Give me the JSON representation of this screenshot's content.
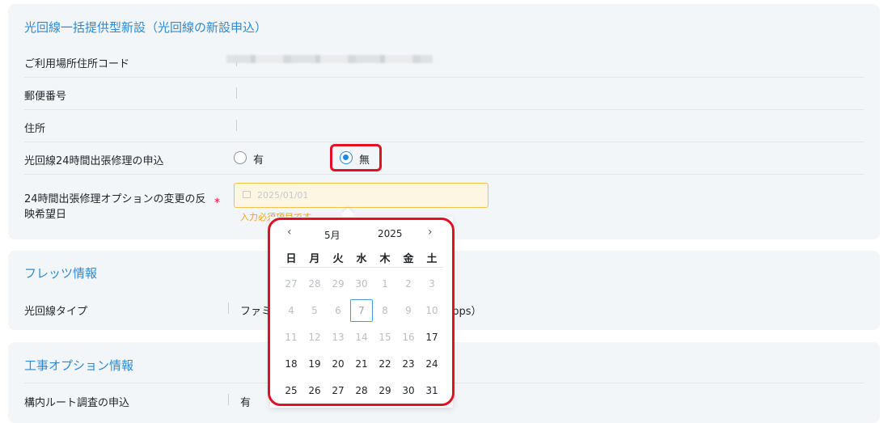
{
  "section1": {
    "title": "光回線一括提供型新設（光回線の新設申込）",
    "rows": {
      "address_code": "ご利用場所住所コード",
      "postal": "郵便番号",
      "address": "住所",
      "repair": "光回線24時間出張修理の申込",
      "desired_date_line1": "24時間出張修理オプションの変更の反",
      "desired_date_line2": "映希望日"
    },
    "radio_yes": "有",
    "radio_no": "無",
    "radio_selected": "無",
    "date_placeholder": "2025/01/01",
    "error_text": "入力必須項目です",
    "required_mark": "*"
  },
  "calendar": {
    "month": "5月",
    "year": "2025",
    "prev_icon": "‹",
    "next_icon": "›",
    "weekdays": [
      "日",
      "月",
      "火",
      "水",
      "木",
      "金",
      "土"
    ],
    "weeks": [
      [
        "27",
        "28",
        "29",
        "30",
        "1",
        "2",
        "3"
      ],
      [
        "4",
        "5",
        "6",
        "7",
        "8",
        "9",
        "10"
      ],
      [
        "11",
        "12",
        "13",
        "14",
        "15",
        "16",
        "17"
      ],
      [
        "18",
        "19",
        "20",
        "21",
        "22",
        "23",
        "24"
      ],
      [
        "25",
        "26",
        "27",
        "28",
        "29",
        "30",
        "31"
      ]
    ],
    "today": "7"
  },
  "section2": {
    "title": "フレッツ情報",
    "line_type_label": "光回線タイプ",
    "line_type_value_start": "ファミ",
    "line_type_value_end": "Mbps）"
  },
  "section3": {
    "title": "工事オプション情報",
    "route_label": "構内ルート調査の申込",
    "route_value": "有"
  },
  "colors": {
    "accent": "#2b8ad3",
    "highlight": "#e01025",
    "radio_on": "#1e88e5",
    "error": "#f0a020"
  }
}
